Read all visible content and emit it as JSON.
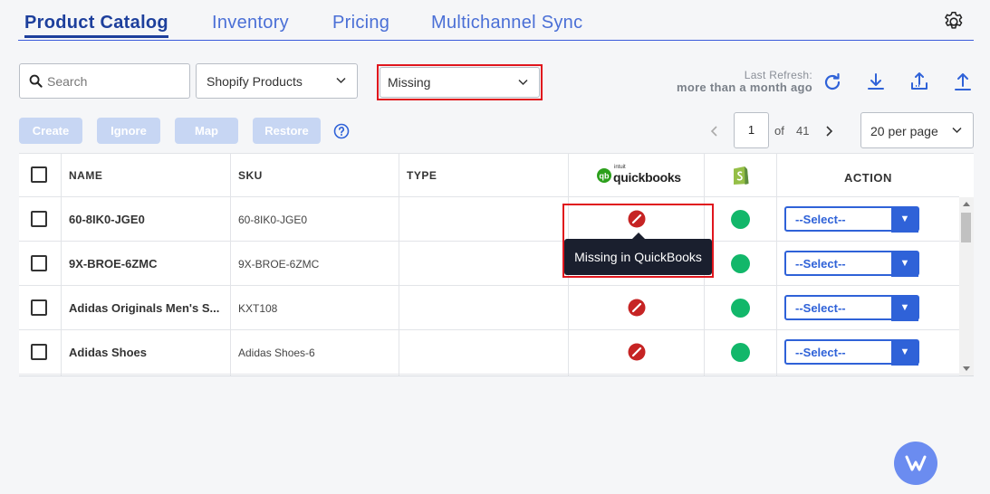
{
  "tabs": [
    {
      "label": "Product Catalog",
      "active": true
    },
    {
      "label": "Inventory"
    },
    {
      "label": "Pricing"
    },
    {
      "label": "Multichannel Sync"
    }
  ],
  "search": {
    "placeholder": "Search"
  },
  "source_select": {
    "value": "Shopify Products"
  },
  "status_select": {
    "value": "Missing"
  },
  "refresh": {
    "label": "Last Refresh:",
    "value": "more than a month ago"
  },
  "buttons": {
    "create": "Create",
    "ignore": "Ignore",
    "map": "Map",
    "restore": "Restore"
  },
  "pager": {
    "page": "1",
    "of": "of",
    "total": "41",
    "per_page": "20 per page"
  },
  "columns": {
    "name": "NAME",
    "sku": "SKU",
    "type": "TYPE",
    "quickbooks_logo": "quickbooks",
    "quickbooks_intuit": "intuit",
    "action": "ACTION"
  },
  "rows": [
    {
      "name": "60-8IK0-JGE0",
      "sku": "60-8IK0-JGE0",
      "type": "",
      "action": "--Select--"
    },
    {
      "name": "9X-BROE-6ZMC",
      "sku": "9X-BROE-6ZMC",
      "type": "",
      "action": "--Select--"
    },
    {
      "name": "Adidas Originals Men's S...",
      "sku": "KXT108",
      "type": "",
      "action": "--Select--"
    },
    {
      "name": "Adidas Shoes",
      "sku": "Adidas Shoes-6",
      "type": "",
      "action": "--Select--"
    }
  ],
  "tooltip": "Missing in QuickBooks",
  "colors": {
    "accent": "#2f62d8",
    "missing": "#c62424",
    "synced": "#12b76a",
    "highlight": "#e0161d"
  }
}
